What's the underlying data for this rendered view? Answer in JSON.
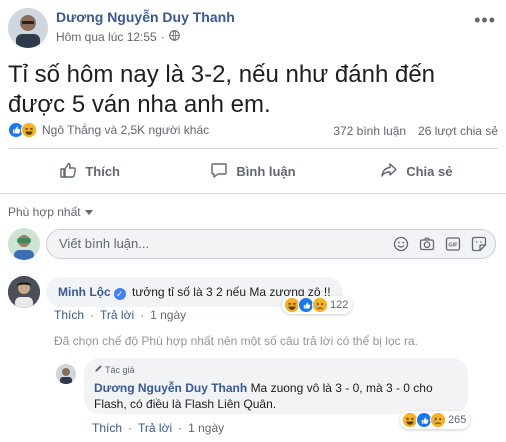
{
  "post": {
    "author": "Dương Nguyễn Duy Thanh",
    "time": "Hôm qua lúc 12:55",
    "more_label": "•••",
    "text": "Tỉ số hôm nay là 3-2, nếu như đánh đến được 5 ván nha anh em.",
    "reaction_summary": "Ngô Thắng và 2,5K người khác",
    "comment_count": "372 bình luận",
    "share_count": "26 lượt chia sẻ"
  },
  "actions": {
    "like": "Thích",
    "comment": "Bình luận",
    "share": "Chia sẻ"
  },
  "comments_section": {
    "sort_label": "Phù hợp nhất",
    "input_placeholder": "Viết bình luận..."
  },
  "comment1": {
    "author": "Minh Lộc",
    "text": "tưởng tỉ số là 3 2 nếu Ma zương zô !!",
    "reaction_count": "122",
    "like": "Thích",
    "reply": "Trả lời",
    "time": "1 ngày"
  },
  "filter_note": "Đã chọn chế độ Phù hợp nhất nên một số câu trả lời có thể bị lọc ra.",
  "reply1": {
    "author_tag": "Tác giả",
    "author": "Dương Nguyễn Duy Thanh",
    "text": "Ma zuong vô là 3 - 0, mà 3 - 0 cho Flash, có điều là Flash Liên Quân.",
    "reaction_count": "265",
    "like": "Thích",
    "reply": "Trả lời",
    "time": "1 ngày"
  },
  "colors": {
    "link": "#385898",
    "like_blue": "#1877f2",
    "haha_yellow": "#f7b125",
    "text_secondary": "#606770"
  },
  "icons": [
    "globe-icon",
    "like-reaction-icon",
    "haha-reaction-icon",
    "sad-reaction-icon",
    "thumbs-up-icon",
    "comment-icon",
    "share-icon",
    "emoji-icon",
    "camera-icon",
    "gif-icon",
    "sticker-icon",
    "verified-icon",
    "pen-icon",
    "chevron-down-icon"
  ]
}
